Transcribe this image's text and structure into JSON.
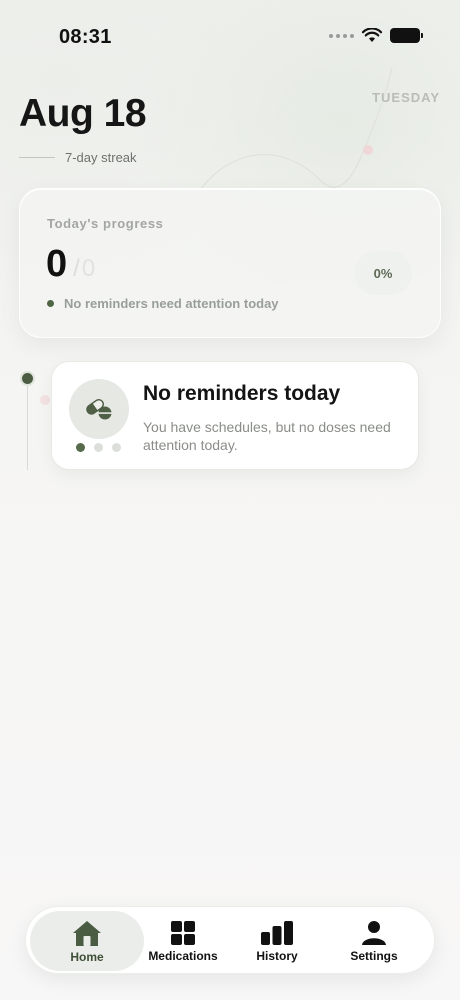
{
  "status_bar": {
    "time": "08:31"
  },
  "header": {
    "date": "Aug 18",
    "weekday": "TUESDAY",
    "streak": "7-day streak"
  },
  "progress_card": {
    "label": "Today's progress",
    "done": "0",
    "separator": "/",
    "total": "0",
    "percent": "0%",
    "percent_value": 0,
    "status": "No reminders need attention today"
  },
  "reminder_card": {
    "title": "No reminders today",
    "description": "You have schedules, but no doses need attention today.",
    "icon": "pills-icon",
    "pager": {
      "count": 3,
      "active_index": 0
    }
  },
  "tab_bar": {
    "active": "Home",
    "items": [
      {
        "label": "Home",
        "icon": "home-icon"
      },
      {
        "label": "Medications",
        "icon": "grid-icon"
      },
      {
        "label": "History",
        "icon": "bar-chart-icon"
      },
      {
        "label": "Settings",
        "icon": "person-icon"
      }
    ]
  },
  "colors": {
    "accent": "#4b5c43",
    "text_primary": "#141414",
    "text_muted": "#8a8d88",
    "background": "#f7f7f6"
  }
}
